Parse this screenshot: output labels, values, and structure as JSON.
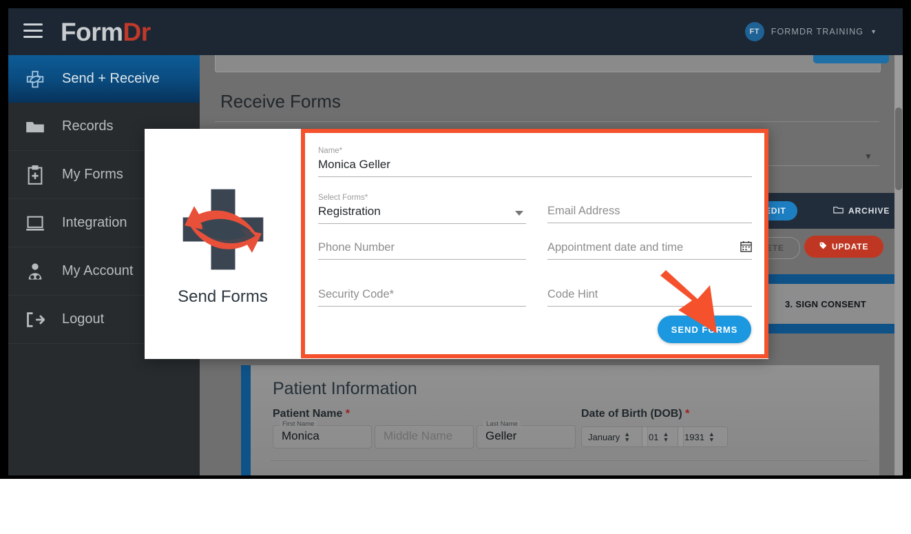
{
  "colors": {
    "brand_red": "#c0392b",
    "highlight_orange": "#f4512c",
    "accent_blue": "#1b98e0",
    "sidebar_bg": "#272b2e",
    "topbar_bg": "#1c2733",
    "update_red": "#bf3722",
    "step_blue": "#0e5288"
  },
  "topbar": {
    "menu_icon": "hamburger-icon",
    "logo_main": "Form",
    "logo_accent": "Dr",
    "account": {
      "initials": "FT",
      "name": "FORMDR TRAINING",
      "caret": "▼"
    }
  },
  "sidebar": {
    "items": [
      {
        "label": "Send + Receive",
        "icon": "send-receive-icon",
        "active": true
      },
      {
        "label": "Records",
        "icon": "folder-icon",
        "active": false
      },
      {
        "label": "My Forms",
        "icon": "clipboard-plus-icon",
        "active": false
      },
      {
        "label": "Integration",
        "icon": "monitor-icon",
        "active": false
      },
      {
        "label": "My Account",
        "icon": "user-doctor-icon",
        "active": false
      },
      {
        "label": "Logout",
        "icon": "logout-icon",
        "active": false
      }
    ]
  },
  "background": {
    "receive_forms_title": "Receive Forms",
    "edit_label": "EDIT",
    "archive_label": "ARCHIVE",
    "delete_label": "ETE",
    "update_label": "UPDATE",
    "step_label": "3. SIGN CONSENT",
    "patient_section": {
      "title": "Patient Information",
      "patient_name_label": "Patient Name",
      "required_mark": "*",
      "first_name_legend": "First Name",
      "first_name_value": "Monica",
      "middle_name_placeholder": "Middle Name",
      "last_name_legend": "Last Name",
      "last_name_value": "Geller",
      "dob_label": "Date of Birth (DOB)",
      "dob_month": "January",
      "dob_day": "01",
      "dob_year": "1931"
    }
  },
  "modal": {
    "left_panel": {
      "logo_icon": "send-forms-cross-arrows-icon",
      "caption": "Send Forms"
    },
    "fields": {
      "name": {
        "label": "Name*",
        "value": "Monica Geller"
      },
      "select_forms": {
        "label": "Select Forms*",
        "value": "Registration",
        "caret_icon": "chevron-down-icon"
      },
      "email": {
        "placeholder": "Email Address"
      },
      "phone": {
        "placeholder": "Phone Number"
      },
      "appointment": {
        "placeholder": "Appointment date and time",
        "icon": "calendar-icon"
      },
      "security_code": {
        "placeholder": "Security Code*"
      },
      "code_hint": {
        "placeholder": "Code Hint"
      }
    },
    "send_button": "SEND FORMS",
    "annotation_arrow": "pointer-arrow-icon"
  }
}
